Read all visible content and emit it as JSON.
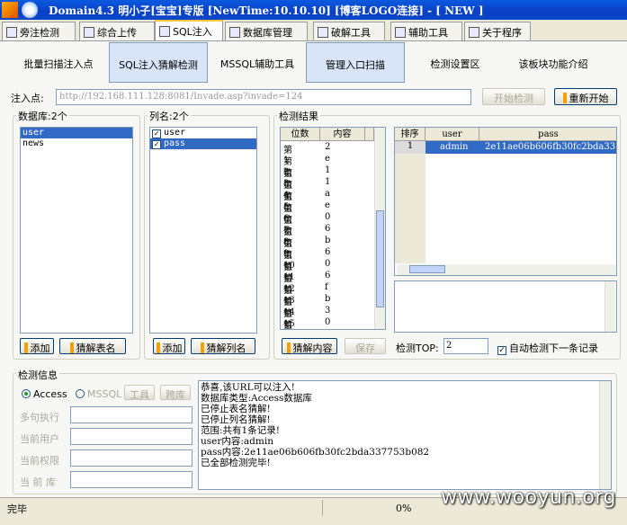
{
  "window": {
    "title": "Domain4.3 明小子[宝宝]专版 [NewTime:10.10.10] [博客LOGO连接]  - [ NEW ]"
  },
  "tabs": [
    "旁注检测",
    "综合上传",
    "SQL注入",
    "数据库管理",
    "破解工具",
    "辅助工具",
    "关于程序"
  ],
  "toolbar": [
    "批量扫描注入点",
    "SQL注入猜解检测",
    "MSSQL辅助工具",
    "管理入口扫描",
    "检测设置区",
    "该板块功能介绍"
  ],
  "inject": {
    "label": "注入点:",
    "url": "http://192.168.111.128:8081/Invade.asp?invade=124",
    "start_btn": "开始检测",
    "restart_btn": "重新开始"
  },
  "db": {
    "title": "数据库:2个",
    "items": [
      "user",
      "news"
    ],
    "add_btn": "添加",
    "guess_btn": "猜解表名"
  },
  "cols": {
    "title": "列名:2个",
    "items": [
      "user",
      "pass"
    ],
    "add_btn": "添加",
    "guess_btn": "猜解列名"
  },
  "result": {
    "title": "检测结果",
    "headers": [
      "位数",
      "内容"
    ],
    "rows": [
      [
        "第1位",
        "2"
      ],
      [
        "第2位",
        "e"
      ],
      [
        "第3位",
        "1"
      ],
      [
        "第4位",
        "1"
      ],
      [
        "第5位",
        "a"
      ],
      [
        "第6位",
        "e"
      ],
      [
        "第7位",
        "0"
      ],
      [
        "第8位",
        "6"
      ],
      [
        "第9位",
        "b"
      ],
      [
        "第10位",
        "6"
      ],
      [
        "第11位",
        "0"
      ],
      [
        "第12位",
        "6"
      ],
      [
        "第13位",
        "f"
      ],
      [
        "第14位",
        "b"
      ],
      [
        "第15位",
        "3"
      ],
      [
        "第16位",
        "0"
      ]
    ],
    "grid_headers": [
      "排序",
      "user",
      "pass"
    ],
    "grid_row": [
      "1",
      "admin",
      "2e11ae06b606fb30fc2bda33"
    ],
    "guess_content_btn": "猜解内容",
    "save_btn": "保存",
    "top_label": "检测TOP:",
    "top_value": "2",
    "auto_label": "自动检测下一条记录"
  },
  "info": {
    "title": "检测信息",
    "access": "Access",
    "mssql": "MSSQL",
    "tool_btn": "工具",
    "cross_btn": "跨库",
    "fields": [
      "多句执行",
      "当前用户",
      "当前权限",
      "当 前 库"
    ],
    "log": [
      "恭喜,该URL可以注入!",
      "数据库类型:Access数据库",
      "已停止表名猜解!",
      "已停止列名猜解!",
      "范围:共有1条记录!",
      "user内容:admin",
      "pass内容:2e11ae06b606fb30fc2bda337753b082",
      "已全部检测完毕!"
    ]
  },
  "status": {
    "text": "完毕",
    "progress": "0%"
  },
  "watermark": "www.wooyun.org"
}
